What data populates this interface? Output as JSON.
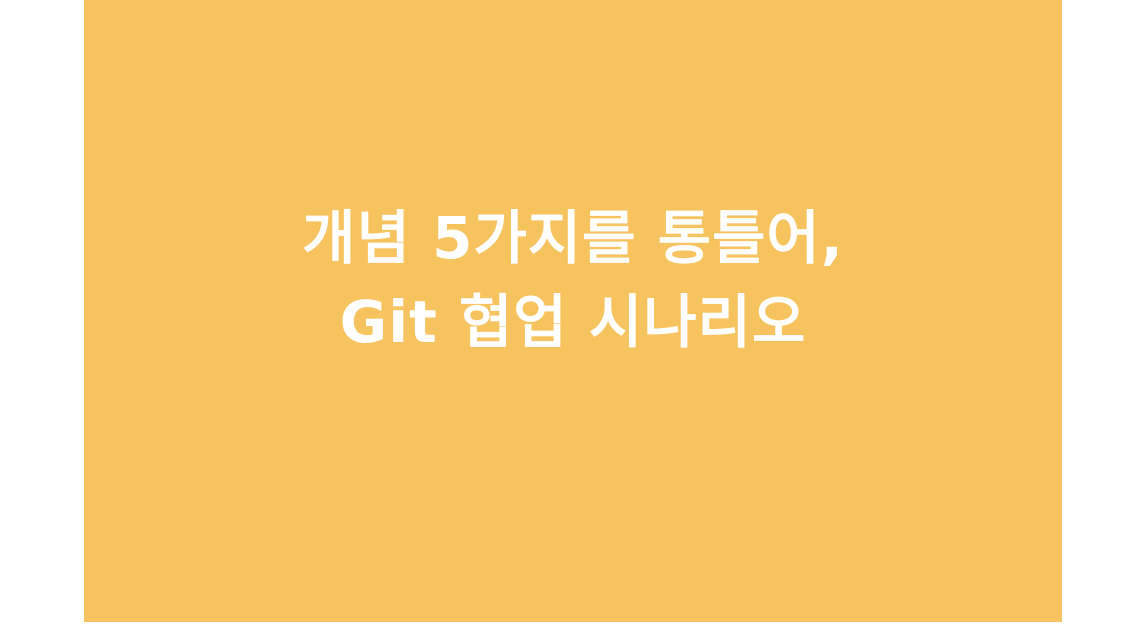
{
  "slide": {
    "background_color": "#f7c35f",
    "text_color": "#ffffff",
    "title_lines": [
      "개념 5가지를 통틀어,",
      "Git 협업 시나리오"
    ]
  }
}
